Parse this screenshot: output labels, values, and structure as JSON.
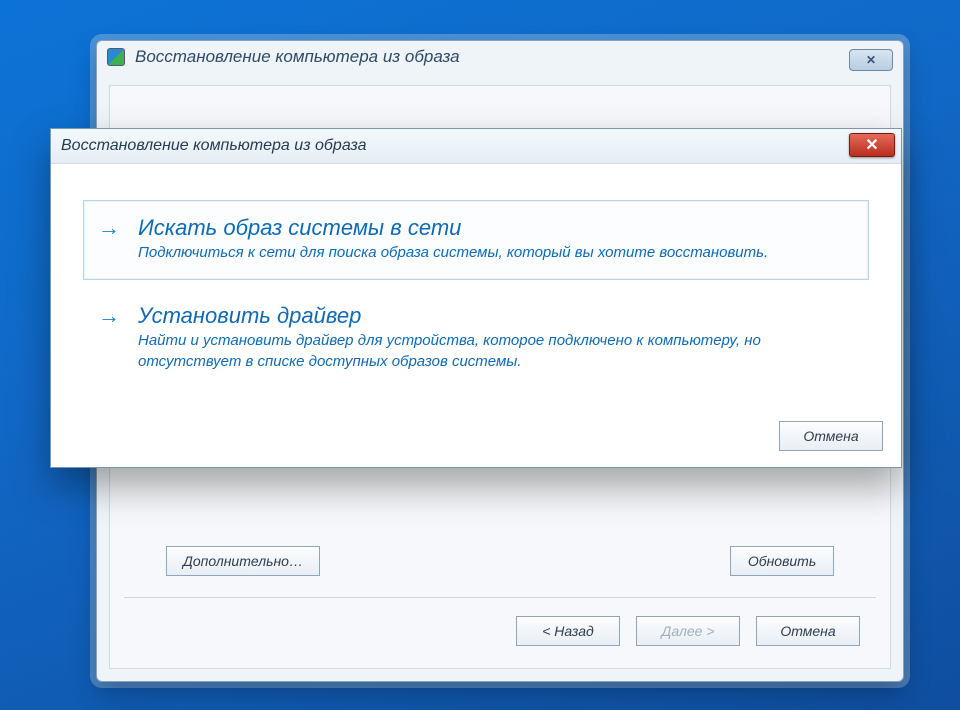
{
  "desktop": {
    "background_color_top": "#0c73d6",
    "background_color_bottom": "#0f4e9f"
  },
  "parent_window": {
    "title": "Восстановление компьютера из образа",
    "buttons": {
      "advanced": "Дополнительно…",
      "refresh": "Обновить",
      "back": "< Назад",
      "next": "Далее >",
      "cancel": "Отмена"
    },
    "next_disabled": true
  },
  "dialog": {
    "title": "Восстановление компьютера из образа",
    "options": [
      {
        "title": "Искать образ системы в сети",
        "desc": "Подключиться к сети для поиска образа системы, который вы хотите восстановить.",
        "selected": true
      },
      {
        "title": "Установить драйвер",
        "desc": "Найти и установить драйвер для устройства, которое подключено к компьютеру, но отсутствует в списке доступных образов системы.",
        "selected": false
      }
    ],
    "cancel_label": "Отмена"
  }
}
